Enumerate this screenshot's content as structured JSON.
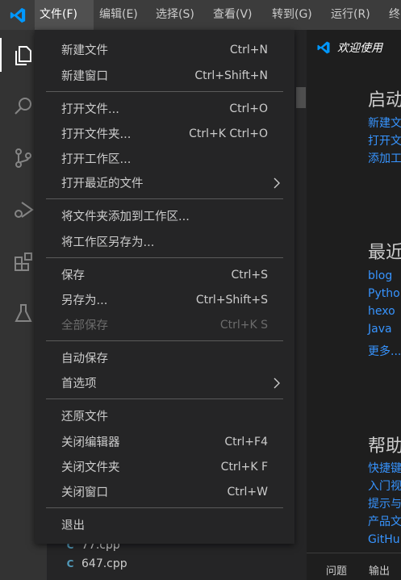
{
  "menubar": {
    "items": [
      {
        "label": "文件(F)"
      },
      {
        "label": "编辑(E)"
      },
      {
        "label": "选择(S)"
      },
      {
        "label": "查看(V)"
      },
      {
        "label": "转到(G)"
      },
      {
        "label": "运行(R)"
      },
      {
        "label": "终"
      }
    ]
  },
  "file_menu": {
    "items": [
      {
        "label": "新建文件",
        "shortcut": "Ctrl+N"
      },
      {
        "label": "新建窗口",
        "shortcut": "Ctrl+Shift+N"
      },
      {
        "label": "打开文件...",
        "shortcut": "Ctrl+O"
      },
      {
        "label": "打开文件夹...",
        "shortcut": "Ctrl+K Ctrl+O"
      },
      {
        "label": "打开工作区...",
        "shortcut": ""
      },
      {
        "label": "打开最近的文件",
        "shortcut": ""
      },
      {
        "label": "将文件夹添加到工作区...",
        "shortcut": ""
      },
      {
        "label": "将工作区另存为...",
        "shortcut": ""
      },
      {
        "label": "保存",
        "shortcut": "Ctrl+S"
      },
      {
        "label": "另存为...",
        "shortcut": "Ctrl+Shift+S"
      },
      {
        "label": "全部保存",
        "shortcut": "Ctrl+K S",
        "disabled": true
      },
      {
        "label": "自动保存",
        "shortcut": ""
      },
      {
        "label": "首选项",
        "shortcut": ""
      },
      {
        "label": "还原文件",
        "shortcut": ""
      },
      {
        "label": "关闭编辑器",
        "shortcut": "Ctrl+F4"
      },
      {
        "label": "关闭文件夹",
        "shortcut": "Ctrl+K F"
      },
      {
        "label": "关闭窗口",
        "shortcut": "Ctrl+W"
      },
      {
        "label": "退出",
        "shortcut": ""
      }
    ]
  },
  "explorer": {
    "files": [
      {
        "name": "77.cpp"
      },
      {
        "name": "647.cpp"
      }
    ]
  },
  "editor": {
    "tab_label": "欢迎使用",
    "welcome": {
      "start_heading": "启动",
      "start_links": [
        "新建文",
        "打开文",
        "添加工"
      ],
      "recent_heading": "最近",
      "recent_links": [
        "blog",
        "Pytho",
        "hexo",
        "Java",
        "更多..."
      ],
      "help_heading": "帮助",
      "help_links": [
        "快捷键",
        "入门视",
        "提示与",
        "产品文",
        "GitHu"
      ]
    }
  },
  "panel": {
    "tabs": [
      "问题",
      "输出"
    ]
  },
  "colors": {
    "accent": "#007acc",
    "link": "#3794ff",
    "menu_bg": "#252526",
    "menubar_bg": "#3c3c3c"
  },
  "icons": [
    "vscode-logo",
    "explorer-icon",
    "search-icon",
    "source-control-icon",
    "run-debug-icon",
    "extensions-icon",
    "testing-icon",
    "chevron-right-icon",
    "cpp-file-icon"
  ]
}
